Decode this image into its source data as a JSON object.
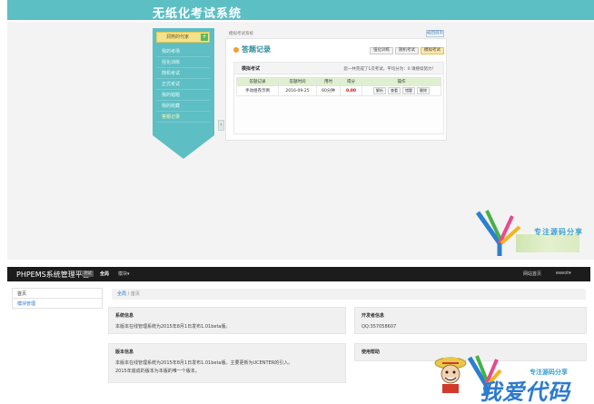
{
  "exam": {
    "title": "无纸化考试系统",
    "nav": {
      "user_label": "洞燕的代家",
      "items": [
        {
          "label": "我的考场"
        },
        {
          "label": "强化训练"
        },
        {
          "label": "随机考试"
        },
        {
          "label": "正式考试"
        },
        {
          "label": "我的错题"
        },
        {
          "label": "我的收藏"
        },
        {
          "label": "答题记录"
        }
      ],
      "toggle": "+"
    },
    "breadcrumb": "模拟考试系统",
    "back_label": "返回首页",
    "section_title": "答题记录",
    "tabs": [
      "强化训练",
      "随机考试",
      "模拟考试"
    ],
    "panel": {
      "title": "模拟考试",
      "summary": "您一共完成了1次考试，平均分为：0 请继续努力！"
    },
    "table": {
      "headers": [
        "答题记录",
        "答题时间",
        "用时",
        "得分",
        "操作"
      ],
      "rows": [
        {
          "name": "手动组卷示例",
          "date": "2016-09-25",
          "duration": "60分钟",
          "score": "0.00",
          "actions": [
            "解析",
            "查看",
            "错题",
            "删除"
          ]
        }
      ]
    },
    "watermark": "专注源码分享"
  },
  "admin": {
    "brand": "PHPEMS系统管理平台",
    "brand_badge": "测试",
    "top_nav": [
      "全局",
      "模块"
    ],
    "right_nav": [
      "网站首页",
      "eeeot"
    ],
    "side": [
      "首页",
      "模块管理"
    ],
    "breadcrumb": {
      "home": "全局",
      "current": "首页"
    },
    "cards": {
      "system": {
        "title": "系统信息",
        "lines": [
          "本版本在线管理系统为2015年8月1日发布1.01beta版。"
        ]
      },
      "developer": {
        "title": "开发者信息",
        "lines": [
          "QQ:357058607"
        ]
      },
      "version": {
        "title": "版本信息",
        "lines": [
          "本版本在线管理系统为2015年8月1日发布1.01beta版。主要更新为UCENTER的引入。",
          "2015年底成的版本为本版的唯一个版本。"
        ]
      },
      "help": {
        "title": "使用帮助",
        "lines": []
      }
    },
    "watermark": {
      "main": "我爱代码",
      "sub": "专注源码分享"
    }
  }
}
